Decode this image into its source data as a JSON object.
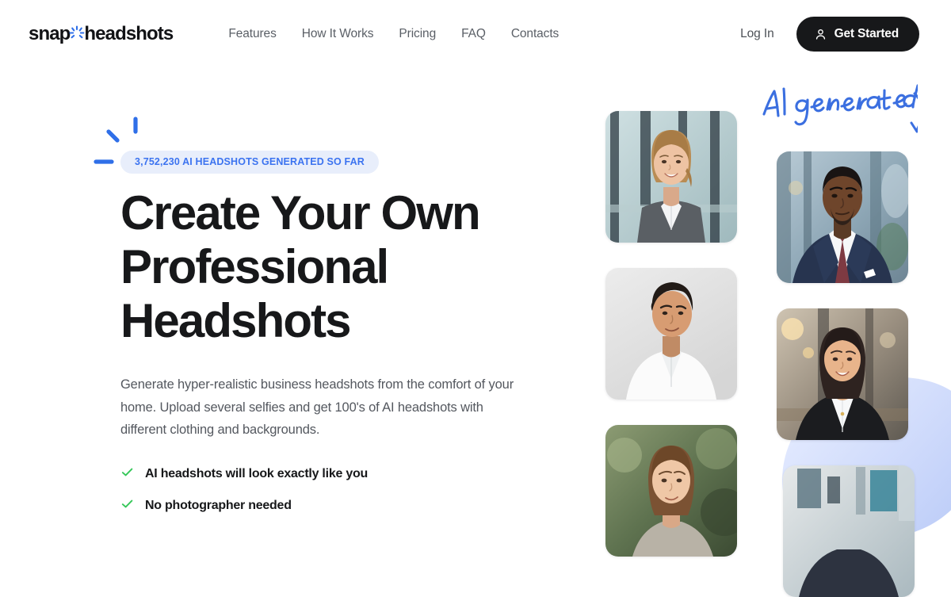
{
  "brand": {
    "name_part1": "snap",
    "name_part2": "headshots",
    "logo_icon": "sparkle-burst-icon",
    "accent_color": "#2f6fe8"
  },
  "header": {
    "nav": [
      {
        "label": "Features",
        "name": "nav-features"
      },
      {
        "label": "How It Works",
        "name": "nav-how-it-works"
      },
      {
        "label": "Pricing",
        "name": "nav-pricing"
      },
      {
        "label": "FAQ",
        "name": "nav-faq"
      },
      {
        "label": "Contacts",
        "name": "nav-contacts"
      }
    ],
    "login_label": "Log In",
    "cta_label": "Get Started",
    "cta_icon": "user-icon",
    "cta_bg": "#17181a"
  },
  "hero": {
    "badge": "3,752,230 AI HEADSHOTS GENERATED SO FAR",
    "badge_bg": "#e8eefb",
    "badge_color": "#3b73f0",
    "title": "Create Your Own Professional Headshots",
    "subtitle": "Generate hyper-realistic business headshots from the comfort of your home. Upload several selfies and get 100's of AI headshots with different clothing and backgrounds.",
    "features": [
      {
        "label": "AI headshots will look exactly like you",
        "icon": "check-icon"
      },
      {
        "label": "No photographer needed",
        "icon": "check-icon"
      }
    ],
    "check_color": "#35c759",
    "sparkle_icon": "sparkle-burst-icon"
  },
  "collage": {
    "annotation": "AI generated",
    "annotation_icon": "curved-arrow-icon",
    "annotation_color": "#3b6fe0",
    "photos": [
      {
        "name": "headshot-woman-gray-blazer",
        "alt": "Blonde woman in gray blazer, glass office background"
      },
      {
        "name": "headshot-man-white-shirt",
        "alt": "Man in white shirt on light gray background"
      },
      {
        "name": "headshot-woman-outdoors",
        "alt": "Woman with brown hair, green outdoor background"
      },
      {
        "name": "headshot-man-navy-suit",
        "alt": "Man in navy suit with burgundy tie, blurred office"
      },
      {
        "name": "headshot-woman-black-blazer",
        "alt": "Woman in black blazer, warm interior background"
      },
      {
        "name": "headshot-person-office",
        "alt": "Person in office, teal window background"
      }
    ]
  }
}
